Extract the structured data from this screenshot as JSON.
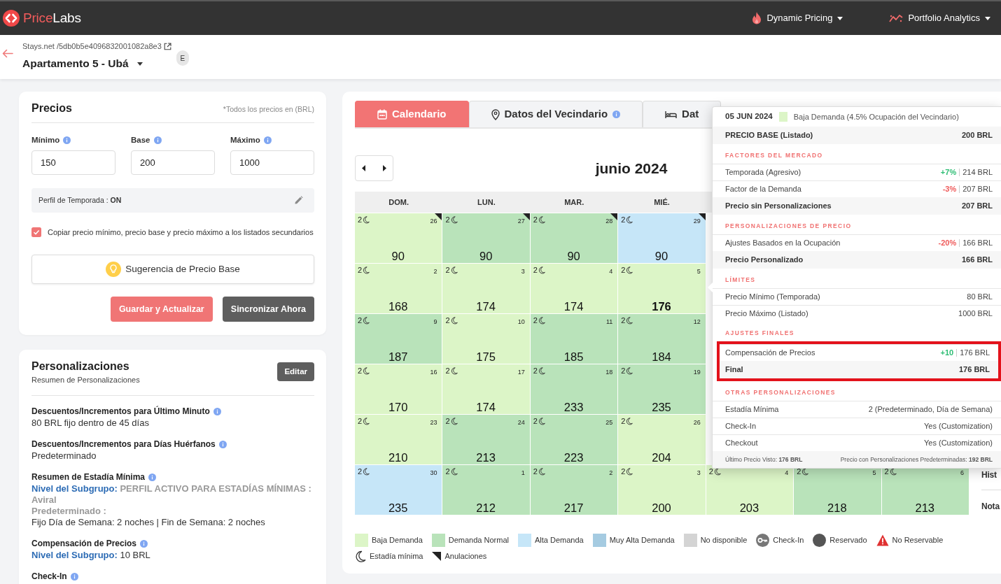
{
  "navbar": {
    "logo": {
      "accent": "Price",
      "rest": "Labs"
    },
    "menus": [
      {
        "label": "Dynamic Pricing"
      },
      {
        "label": "Portfolio Analytics"
      }
    ]
  },
  "listing": {
    "source": "Stays.net /5db0b5e4096832001082a8e3",
    "name": "Apartamento 5 - Ubá",
    "badge": "E"
  },
  "prices": {
    "title": "Precios",
    "note": "*Todos los precios en (BRL)",
    "fields": [
      {
        "label": "Mínimo",
        "value": "150"
      },
      {
        "label": "Base",
        "value": "200"
      },
      {
        "label": "Máximo",
        "value": "1000"
      }
    ],
    "season_profile": "Perfil de Temporada : **ON**",
    "copy_option": {
      "label": "Copiar precio mínimo, precio base y precio máximo a los listados secundarios",
      "checked": true
    },
    "suggest_button": "Sugerencia de Precio Base",
    "buttons": [
      {
        "label": "Guardar y Actualizar",
        "kind": "primary"
      },
      {
        "label": "Sincronizar Ahora",
        "kind": "secondary"
      }
    ]
  },
  "customizations": {
    "title": "Personalizaciones",
    "subtitle": "Resumen de Personalizaciones",
    "edit_button": "Editar",
    "items": [
      {
        "title": "Descuentos/Incrementos para Último Minuto",
        "lines": [
          [
            {
              "kind": "plain",
              "text": "80 BRL fijo dentro de 45 días"
            }
          ]
        ]
      },
      {
        "title": "Descuentos/Incrementos para Días Huérfanos",
        "lines": [
          [
            {
              "kind": "plain",
              "text": "Predeterminado"
            }
          ]
        ]
      },
      {
        "title": "Resumen de Estadía Mínima",
        "lines": [
          [
            {
              "kind": "subgroup",
              "text": "Nivel del Subgrupo:"
            },
            {
              "kind": "muted",
              "text": "PERFIL ACTIVO PARA ESTADÍAS MÍNIMAS : Aviral"
            }
          ],
          [
            {
              "kind": "muted",
              "text": "Predeterminado :"
            }
          ],
          [
            {
              "kind": "plain",
              "text": "Fijo Día de Semana: 2 noches | Fin de Semana: 2 noches"
            }
          ]
        ]
      },
      {
        "title": "Compensación de Precios",
        "lines": [
          [
            {
              "kind": "subgroup",
              "text": "Nivel del Subgrupo:"
            },
            {
              "kind": "plain",
              "text": "10 BRL"
            }
          ]
        ]
      },
      {
        "title": "Check-In"
      }
    ]
  },
  "tabs": [
    {
      "label": "Calendario",
      "selected": true
    },
    {
      "label": "Datos del Vecindario",
      "info_icon": true,
      "selected": false
    },
    {
      "label": "Dat",
      "selected": false
    }
  ],
  "calendar": {
    "month": "junio 2024",
    "weekdays": [
      "DOM.",
      "LUN.",
      "MAR.",
      "MIÉ."
    ],
    "weeks": [
      [
        {
          "min_stay": "2",
          "day": "26",
          "price": "90",
          "color": "#dcf5c7",
          "cancellations": true,
          "selected": false
        },
        {
          "min_stay": "2",
          "day": "27",
          "price": "90",
          "color": "#b9e3ba",
          "cancellations": true,
          "selected": false
        },
        {
          "min_stay": "2",
          "day": "28",
          "price": "90",
          "color": "#b9e3ba",
          "cancellations": true,
          "selected": false
        },
        {
          "min_stay": "2",
          "day": "29",
          "price": "90",
          "color": "#c6e6f8",
          "cancellations": true,
          "selected": false
        }
      ],
      [
        {
          "min_stay": "2",
          "day": "2",
          "price": "168",
          "color": "#dcf5c7",
          "cancellations": false,
          "selected": false
        },
        {
          "min_stay": "2",
          "day": "3",
          "price": "174",
          "color": "#dcf5c7",
          "cancellations": false,
          "selected": false
        },
        {
          "min_stay": "2",
          "day": "4",
          "price": "174",
          "color": "#dcf5c7",
          "cancellations": false,
          "selected": false
        },
        {
          "min_stay": "2",
          "day": "5",
          "price": "176",
          "color": "#dcf5c7",
          "cancellations": false,
          "selected": true
        }
      ],
      [
        {
          "min_stay": "2",
          "day": "9",
          "price": "187",
          "color": "#b9e3ba",
          "cancellations": false,
          "selected": false
        },
        {
          "min_stay": "2",
          "day": "10",
          "price": "175",
          "color": "#dcf5c7",
          "cancellations": false,
          "selected": false
        },
        {
          "min_stay": "2",
          "day": "11",
          "price": "185",
          "color": "#b9e3ba",
          "cancellations": false,
          "selected": false
        },
        {
          "min_stay": "2",
          "day": "12",
          "price": "184",
          "color": "#b9e3ba",
          "cancellations": false,
          "selected": false
        }
      ],
      [
        {
          "min_stay": "2",
          "day": "16",
          "price": "170",
          "color": "#dcf5c7",
          "cancellations": false,
          "selected": false
        },
        {
          "min_stay": "2",
          "day": "17",
          "price": "174",
          "color": "#dcf5c7",
          "cancellations": false,
          "selected": false
        },
        {
          "min_stay": "2",
          "day": "18",
          "price": "233",
          "color": "#b9e3ba",
          "cancellations": false,
          "selected": false
        },
        {
          "min_stay": "2",
          "day": "19",
          "price": "235",
          "color": "#b9e3ba",
          "cancellations": false,
          "selected": false
        }
      ],
      [
        {
          "min_stay": "2",
          "day": "23",
          "price": "210",
          "color": "#dcf5c7",
          "cancellations": false,
          "selected": false
        },
        {
          "min_stay": "2",
          "day": "24",
          "price": "213",
          "color": "#b9e3ba",
          "cancellations": false,
          "selected": false
        },
        {
          "min_stay": "2",
          "day": "25",
          "price": "223",
          "color": "#b9e3ba",
          "cancellations": false,
          "selected": false
        },
        {
          "min_stay": "2",
          "day": "26",
          "price": "204",
          "color": "#dcf5c7",
          "cancellations": false,
          "selected": false
        }
      ],
      [
        {
          "min_stay": "2",
          "day": "30",
          "price": "235",
          "color": "#c6e6f8",
          "cancellations": false,
          "selected": false
        },
        {
          "min_stay": "2",
          "day": "1",
          "price": "212",
          "color": "#b9e3ba",
          "cancellations": false,
          "selected": false
        },
        {
          "min_stay": "2",
          "day": "2",
          "price": "217",
          "color": "#b9e3ba",
          "cancellations": false,
          "selected": false
        },
        {
          "min_stay": "2",
          "day": "3",
          "price": "200",
          "color": "#dcf5c7",
          "cancellations": false,
          "selected": false
        },
        {
          "min_stay": "2",
          "day": "4",
          "price": "203",
          "color": "#dcf5c7",
          "cancellations": false,
          "selected": false
        },
        {
          "min_stay": "2",
          "day": "5",
          "price": "218",
          "color": "#b9e3ba",
          "cancellations": false,
          "selected": false
        },
        {
          "min_stay": "2",
          "day": "6",
          "price": "213",
          "color": "#b9e3ba",
          "cancellations": false,
          "selected": false
        }
      ]
    ]
  },
  "side_panel": {
    "labels": [
      "Hist",
      "Nota"
    ]
  },
  "legend": [
    {
      "kind": "swatch",
      "label": "Baja Demanda",
      "color": "#dcf5c7"
    },
    {
      "kind": "swatch",
      "label": "Demanda Normal",
      "color": "#b9e3ba"
    },
    {
      "kind": "swatch",
      "label": "Alta Demanda",
      "color": "#c6e6f8"
    },
    {
      "kind": "swatch",
      "label": "Muy Alta Demanda",
      "color": "#a5cbe1"
    },
    {
      "kind": "swatch",
      "label": "No disponible",
      "color": "#d4d4d4"
    },
    {
      "kind": "key",
      "label": "Check-In"
    },
    {
      "kind": "booked",
      "label": "Reservado"
    },
    {
      "kind": "warning",
      "label": "No Reservable"
    },
    {
      "kind": "moon",
      "label": "Estadía mínima"
    },
    {
      "kind": "corner",
      "label": "Anulaciones"
    }
  ],
  "popup": {
    "date": "05 JUN 2024",
    "demand": {
      "color": "#dcf5c7",
      "label": "Baja Demanda (4.5% Ocupación del Vecindario)"
    },
    "rows": [
      {
        "kind": "total",
        "label": "PRECIO BASE (Listado)",
        "value": "200 BRL",
        "highlighted": false
      },
      {
        "kind": "section",
        "label": "FACTORES DEL MERCADO",
        "highlighted": false
      },
      {
        "kind": "gain",
        "label": "Temporada (Agresivo)",
        "change": "+7%",
        "value": "214 BRL",
        "highlighted": false
      },
      {
        "kind": "loss",
        "label": "Factor de la Demanda",
        "change": "-3%",
        "value": "207 BRL",
        "highlighted": false
      },
      {
        "kind": "total",
        "label": "Precio sin Personalizaciones",
        "value": "207 BRL",
        "highlighted": false
      },
      {
        "kind": "section",
        "label": "PERSONALIZACIONES DE PRECIO",
        "highlighted": false
      },
      {
        "kind": "loss",
        "label": "Ajustes Basados en la Ocupación",
        "change": "-20%",
        "value": "166 BRL",
        "highlighted": false
      },
      {
        "kind": "total",
        "label": "Precio Personalizado",
        "value": "166 BRL",
        "highlighted": false
      },
      {
        "kind": "section",
        "label": "LÍMITES",
        "highlighted": false
      },
      {
        "kind": "item",
        "label": "Precio Mínimo (Temporada)",
        "value": "80 BRL",
        "highlighted": false
      },
      {
        "kind": "item",
        "label": "Precio Máximo (Listado)",
        "value": "1000 BRL",
        "highlighted": false
      },
      {
        "kind": "section",
        "label": "AJUSTES FINALES",
        "highlighted": false
      },
      {
        "kind": "gain",
        "label": "Compensación de Precios",
        "change": "+10",
        "value": "176 BRL",
        "highlighted": true
      },
      {
        "kind": "total",
        "label": "Final",
        "value": "176 BRL",
        "highlighted": true
      },
      {
        "kind": "section",
        "label": "OTRAS PERSONALIZACIONES",
        "highlighted": false
      },
      {
        "kind": "item",
        "label": "Estadía Mínima",
        "value": "2 (Predeterminado, Día de Semana)",
        "highlighted": false
      },
      {
        "kind": "item",
        "label": "Check-In",
        "value": "Yes (Customization)",
        "highlighted": false
      },
      {
        "kind": "item",
        "label": "Checkout",
        "value": "Yes (Customization)",
        "highlighted": false
      }
    ],
    "footer": [
      "Último Precio Visto: **176 BRL**",
      "Precio con Personalizaciones Predeterminadas: **192 BRL**"
    ]
  }
}
